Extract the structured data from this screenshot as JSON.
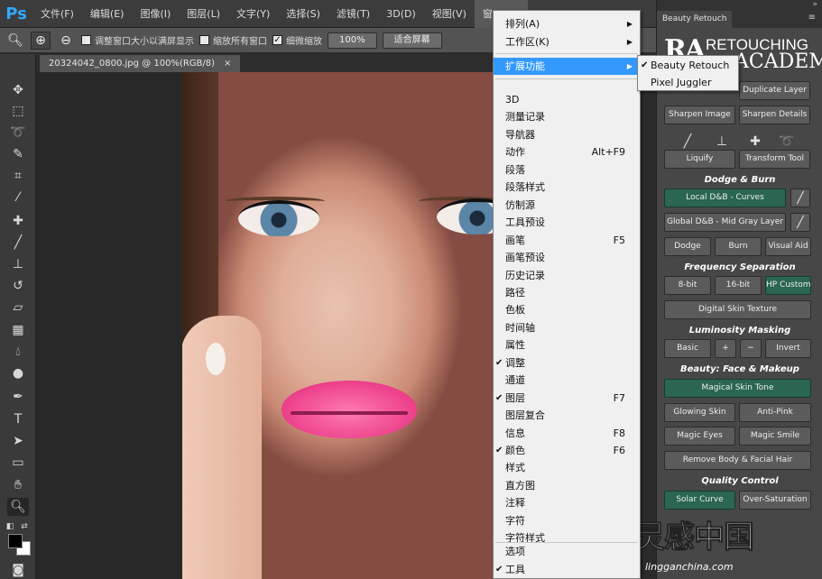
{
  "app": {
    "logo": "Ps"
  },
  "menubar": {
    "items": [
      "文件(F)",
      "编辑(E)",
      "图像(I)",
      "图层(L)",
      "文字(Y)",
      "选择(S)",
      "滤镜(T)",
      "3D(D)",
      "视图(V)",
      "窗口(W)"
    ],
    "active_item": "窗口(W)"
  },
  "options_bar": {
    "resize_windows": "调整窗口大小以满屏显示",
    "zoom_all_windows": "缩放所有窗口",
    "scrubby_zoom": "细微缩放",
    "zoom_percent": "100%",
    "fit_screen": "适合屏幕"
  },
  "document": {
    "tab_title": "20324042_0800.jpg @ 100%(RGB/8)",
    "close": "×"
  },
  "window_menu": {
    "top_items": [
      {
        "label": "排列(A)",
        "submenu": true
      },
      {
        "label": "工作区(K)",
        "submenu": true
      }
    ],
    "extensions": {
      "label": "扩展功能",
      "submenu": true,
      "highlighted": true
    },
    "panels": [
      {
        "label": "3D",
        "shortcut": "",
        "checked": false
      },
      {
        "label": "测量记录",
        "shortcut": "",
        "checked": false
      },
      {
        "label": "导航器",
        "shortcut": "",
        "checked": false
      },
      {
        "label": "动作",
        "shortcut": "Alt+F9",
        "checked": false
      },
      {
        "label": "段落",
        "shortcut": "",
        "checked": false
      },
      {
        "label": "段落样式",
        "shortcut": "",
        "checked": false
      },
      {
        "label": "仿制源",
        "shortcut": "",
        "checked": false
      },
      {
        "label": "工具预设",
        "shortcut": "",
        "checked": false
      },
      {
        "label": "画笔",
        "shortcut": "F5",
        "checked": false
      },
      {
        "label": "画笔预设",
        "shortcut": "",
        "checked": false
      },
      {
        "label": "历史记录",
        "shortcut": "",
        "checked": false
      },
      {
        "label": "路径",
        "shortcut": "",
        "checked": false
      },
      {
        "label": "色板",
        "shortcut": "",
        "checked": false
      },
      {
        "label": "时间轴",
        "shortcut": "",
        "checked": false
      },
      {
        "label": "属性",
        "shortcut": "",
        "checked": false
      },
      {
        "label": "调整",
        "shortcut": "",
        "checked": true
      },
      {
        "label": "通道",
        "shortcut": "",
        "checked": false
      },
      {
        "label": "图层",
        "shortcut": "F7",
        "checked": true
      },
      {
        "label": "图层复合",
        "shortcut": "",
        "checked": false
      },
      {
        "label": "信息",
        "shortcut": "F8",
        "checked": false
      },
      {
        "label": "颜色",
        "shortcut": "F6",
        "checked": true
      },
      {
        "label": "样式",
        "shortcut": "",
        "checked": false
      },
      {
        "label": "直方图",
        "shortcut": "",
        "checked": false
      },
      {
        "label": "注释",
        "shortcut": "",
        "checked": false
      },
      {
        "label": "字符",
        "shortcut": "",
        "checked": false
      },
      {
        "label": "字符样式",
        "shortcut": "",
        "checked": false
      }
    ],
    "bottom_items": [
      {
        "label": "选项",
        "checked": false
      },
      {
        "label": "工具",
        "checked": true
      }
    ]
  },
  "extensions_submenu": [
    {
      "label": "Beauty Retouch",
      "checked": true
    },
    {
      "label": "Pixel Juggler",
      "checked": false
    }
  ],
  "panel": {
    "tab": "Beauty Retouch",
    "logo": {
      "mark": "RA",
      "line1": "RETOUCHING",
      "line2": "ACADEMY"
    },
    "duplicate_layer": "Duplicate Layer",
    "sharpen_image": "Sharpen Image",
    "sharpen_details": "Sharpen Details",
    "liquify": "Liquify",
    "transform_tool": "Transform Tool",
    "dodge_burn_title": "Dodge & Burn",
    "local_db": "Local D&B - Curves",
    "global_db": "Global D&B - Mid Gray Layer",
    "dodge": "Dodge",
    "burn": "Burn",
    "visual_aid": "Visual Aid",
    "freq_sep_title": "Frequency Separation",
    "eight_bit": "8-bit",
    "sixteen_bit": "16-bit",
    "hp_custom": "HP Custom",
    "digital_skin_texture": "Digital Skin Texture",
    "lum_mask_title": "Luminosity Masking",
    "basic": "Basic",
    "plus": "+",
    "minus": "−",
    "invert": "Invert",
    "face_makeup_title": "Beauty: Face & Makeup",
    "magical_skin_tone": "Magical Skin Tone",
    "glowing_skin": "Glowing Skin",
    "anti_pink": "Anti-Pink",
    "magic_eyes": "Magic Eyes",
    "magic_smile": "Magic Smile",
    "remove_body_hair": "Remove Body & Facial Hair",
    "quality_title": "Quality Control",
    "solar_curve": "Solar Curve",
    "over_saturation": "Over-Saturation"
  },
  "watermark": {
    "big": "灵感中国",
    "small": "lingganchina.com"
  },
  "colors": {
    "accent_highlight": "#3399ff",
    "green_button": "#2a6652",
    "ps_blue": "#31a8ff"
  }
}
